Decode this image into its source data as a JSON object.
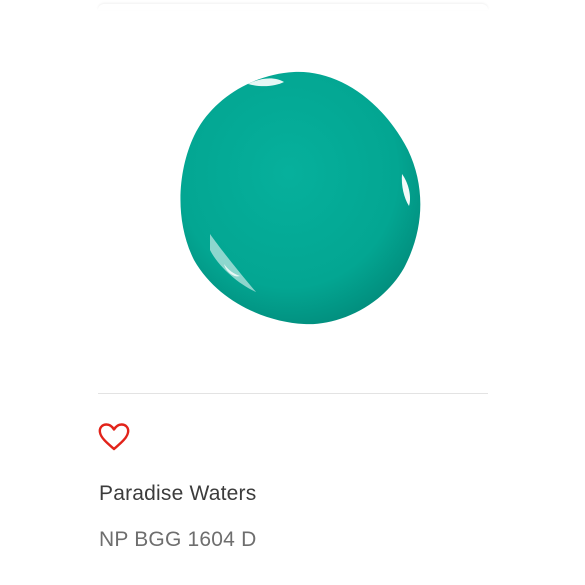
{
  "product": {
    "name": "Paradise Waters",
    "code": "NP BGG 1604 D"
  },
  "swatch": {
    "color": "#03A996"
  },
  "favorite": {
    "icon": "heart-outline-icon",
    "color": "#e2231a"
  }
}
